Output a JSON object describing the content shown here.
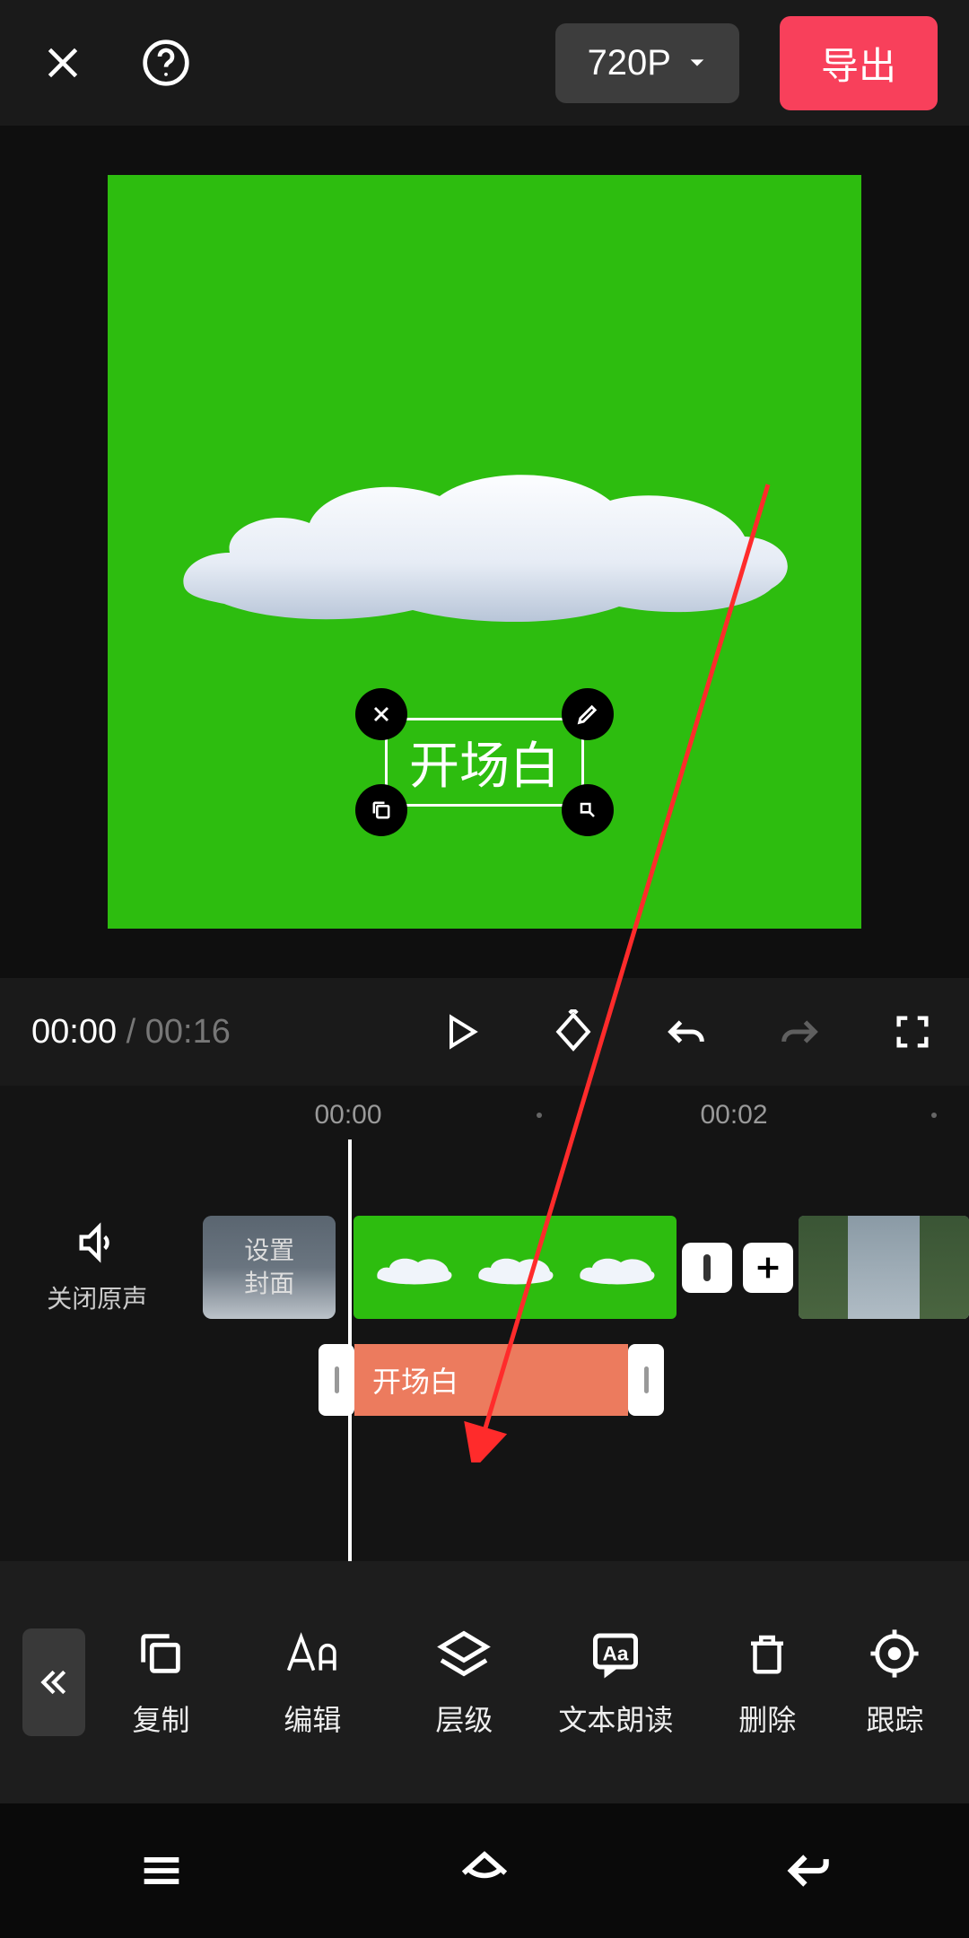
{
  "header": {
    "resolution_label": "720P",
    "export_label": "导出"
  },
  "preview": {
    "text_overlay": "开场白"
  },
  "playbar": {
    "current_time": "00:00",
    "total_time": "00:16"
  },
  "ruler": {
    "marks": [
      "00:00",
      "00:02"
    ]
  },
  "timeline": {
    "mute_label": "关闭原声",
    "cover_label_line1": "设置",
    "cover_label_line2": "封面",
    "text_clip_label": "开场白"
  },
  "toolbar": {
    "items": [
      {
        "label": "复制",
        "icon": "copy"
      },
      {
        "label": "编辑",
        "icon": "text-aa"
      },
      {
        "label": "层级",
        "icon": "layers"
      },
      {
        "label": "文本朗读",
        "icon": "tts"
      },
      {
        "label": "删除",
        "icon": "trash"
      },
      {
        "label": "跟踪",
        "icon": "target"
      }
    ]
  }
}
